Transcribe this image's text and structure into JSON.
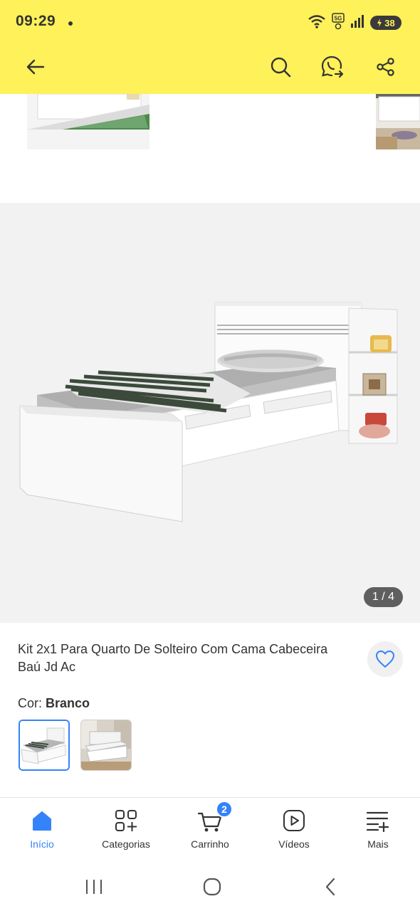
{
  "status_bar": {
    "time": "09:29",
    "battery": "38",
    "icons": [
      "wifi-icon",
      "5g-icon",
      "signal-icon",
      "battery-icon"
    ]
  },
  "nav": {
    "icons": [
      "back-arrow-icon",
      "search-icon",
      "whatsapp-share-icon",
      "share-icon"
    ]
  },
  "gallery": {
    "counter": "1 / 4",
    "current_index": 1,
    "total": 4
  },
  "product": {
    "title": "Kit 2x1 Para Quarto De Solteiro Com Cama Cabeceira Baú Jd Ac",
    "color_label": "Cor: ",
    "color_value": "Branco",
    "swatches": [
      "white-bed-swatch",
      "room-bed-swatch"
    ],
    "selected_swatch": 0
  },
  "tabbar": {
    "items": [
      {
        "label": "Início",
        "icon": "home-icon",
        "active": true
      },
      {
        "label": "Categorias",
        "icon": "categories-icon",
        "active": false
      },
      {
        "label": "Carrinho",
        "icon": "cart-icon",
        "active": false,
        "badge": "2"
      },
      {
        "label": "Vídeos",
        "icon": "video-icon",
        "active": false
      },
      {
        "label": "Mais",
        "icon": "menu-plus-icon",
        "active": false
      }
    ]
  },
  "system_nav": {
    "icons": [
      "recents-icon",
      "home-circle-icon",
      "back-chevron-icon"
    ]
  },
  "colors": {
    "header_yellow": "#fff159",
    "accent_blue": "#3483fa",
    "gallery_bg": "#f2f2f2",
    "text": "#333333"
  }
}
